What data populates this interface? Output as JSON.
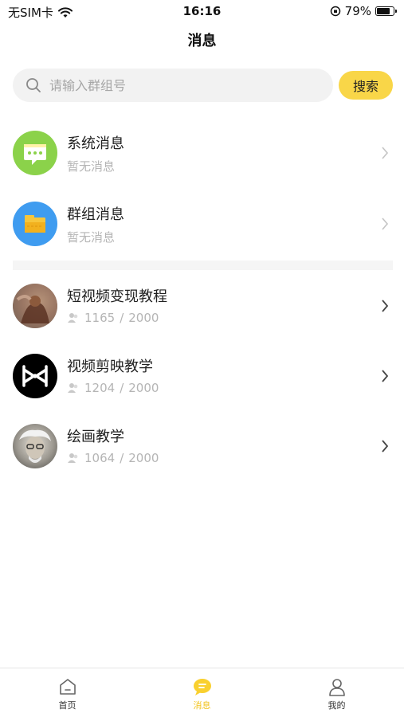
{
  "status_bar": {
    "carrier": "无SIM卡",
    "time": "16:16",
    "battery": "79%",
    "battery_level": 0.79
  },
  "header": {
    "title": "消息"
  },
  "search": {
    "placeholder": "请输入群组号",
    "value": "",
    "button_label": "搜索"
  },
  "system_items": [
    {
      "title": "系统消息",
      "subtitle": "暂无消息",
      "icon": "chat-bubble-icon",
      "color": "#8bd24a"
    },
    {
      "title": "群组消息",
      "subtitle": "暂无消息",
      "icon": "folder-icon",
      "color": "#3f9cf0"
    }
  ],
  "groups": [
    {
      "name": "短视频变现教程",
      "members": "1165",
      "capacity": "2000",
      "separator": "/",
      "avatar": "photo-avatar"
    },
    {
      "name": "视频剪映教学",
      "members": "1204",
      "capacity": "2000",
      "separator": "/",
      "avatar": "capcut-logo-avatar"
    },
    {
      "name": "绘画教学",
      "members": "1064",
      "capacity": "2000",
      "separator": "/",
      "avatar": "portrait-avatar"
    }
  ],
  "tabs": [
    {
      "label": "首页",
      "icon": "home-icon",
      "active": false
    },
    {
      "label": "消息",
      "icon": "message-icon",
      "active": true
    },
    {
      "label": "我的",
      "icon": "user-icon",
      "active": false
    }
  ],
  "colors": {
    "accent": "#f9d648",
    "active_tab": "#f2c21a",
    "muted_text": "#b5b5b5"
  }
}
